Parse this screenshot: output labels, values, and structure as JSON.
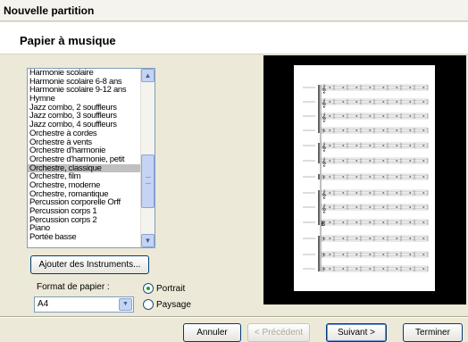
{
  "window": {
    "title": "Nouvelle partition"
  },
  "section": {
    "title": "Papier à musique"
  },
  "ensembles": {
    "items": [
      "Harmonie scolaire",
      "Harmonie scolaire 6-8 ans",
      "Harmonie scolaire 9-12 ans",
      "Hymne",
      "Jazz combo, 2 souffleurs",
      "Jazz combo, 3 souffleurs",
      "Jazz combo, 4 souffleurs",
      "Orchestre à cordes",
      "Orchestre à vents",
      "Orchestre d'harmonie",
      "Orchestre d'harmonie, petit",
      "Orchestre, classique",
      "Orchestre, film",
      "Orchestre, moderne",
      "Orchestre, romantique",
      "Percussion corporelle Orff",
      "Percussion corps 1",
      "Percussion corps 2",
      "Piano",
      "Portée basse"
    ],
    "selected": "Orchestre, classique"
  },
  "buttons": {
    "add_instruments": "Ajouter des Instruments...",
    "cancel": "Annuler",
    "previous": "< Précédent",
    "next": "Suivant >",
    "finish": "Terminer"
  },
  "paper": {
    "format_label": "Format de papier :",
    "format_value": "A4",
    "orientation_portrait": "Portrait",
    "orientation_landscape": "Paysage",
    "orientation_selected": "Portrait"
  },
  "icons": {
    "scroll_up": "up-arrow-icon",
    "scroll_down": "down-arrow-icon",
    "combo_arrow": "chevron-down-icon"
  }
}
